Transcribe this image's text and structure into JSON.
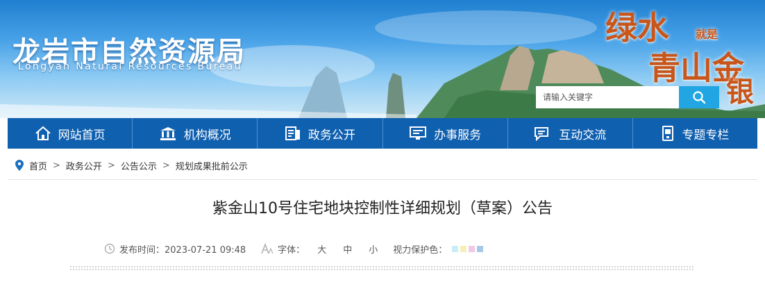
{
  "site": {
    "name_cn": "龙岩市自然资源局",
    "name_en": "Longyan Natural Resources Bureau"
  },
  "slogan": {
    "part1": "绿水",
    "part2": "就是",
    "part3": "青山金",
    "part4": "银"
  },
  "search": {
    "placeholder": "请输入关键字",
    "button_icon": "magnifier-icon"
  },
  "nav": {
    "items": [
      {
        "label": "网站首页",
        "icon": "home-icon"
      },
      {
        "label": "机构概况",
        "icon": "institution-icon"
      },
      {
        "label": "政务公开",
        "icon": "document-list-icon"
      },
      {
        "label": "办事服务",
        "icon": "monitor-icon"
      },
      {
        "label": "互动交流",
        "icon": "chat-icon"
      },
      {
        "label": "专题专栏",
        "icon": "mobile-icon"
      }
    ]
  },
  "breadcrumb": {
    "icon": "location-pin-icon",
    "items": [
      "首页",
      "政务公开",
      "公告公示",
      "规划成果批前公示"
    ],
    "separator": ">"
  },
  "article": {
    "title": "紫金山10号住宅地块控制性详细规划（草案）公告",
    "publish_label": "发布时间：",
    "publish_time": "2023-07-21 09:48",
    "font_label": "字体：",
    "font_sizes": [
      "大",
      "中",
      "小"
    ],
    "eye_label": "视力保护色：",
    "eye_colors": [
      "#c8eef6",
      "#f5f0b8",
      "#f0c8e8",
      "#a8c8e8"
    ]
  },
  "colors": {
    "nav_bg": "#1060b0",
    "search_btn": "#21a6e3",
    "slogan": "#c8561a"
  }
}
